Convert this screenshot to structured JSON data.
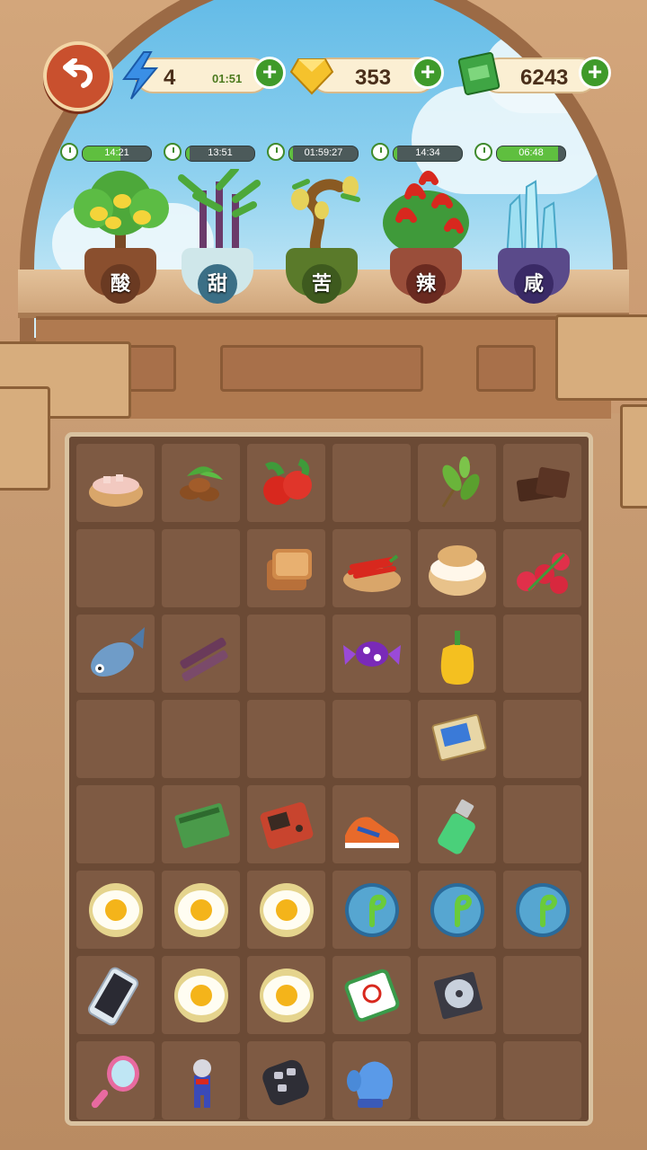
{
  "top_bar": {
    "energy": {
      "value": "4",
      "timer": "01:51"
    },
    "gems": {
      "value": "353"
    },
    "cash": {
      "value": "6243"
    }
  },
  "plants": [
    {
      "label": "酸",
      "timer": "14:21",
      "progress": 0.55,
      "icon": "lemon-tree-icon"
    },
    {
      "label": "甜",
      "timer": "13:51",
      "progress": 0.05,
      "icon": "sugarcane-plant-icon"
    },
    {
      "label": "苦",
      "timer": "01:59:27",
      "progress": 0.05,
      "icon": "bitter-gourd-plant-icon"
    },
    {
      "label": "辣",
      "timer": "14:34",
      "progress": 0.05,
      "icon": "chili-plant-icon"
    },
    {
      "label": "咸",
      "timer": "06:48",
      "progress": 0.9,
      "icon": "salt-crystal-plant-icon"
    }
  ],
  "board": {
    "rows": [
      [
        "salt-bowl",
        "coffee-beans",
        "hawthorn-berries",
        "",
        "tea-leaves",
        "chocolate"
      ],
      [
        "",
        "",
        "toast-bread",
        "chili-bowl",
        "cream-puff",
        "raspberries"
      ],
      [
        "fish",
        "sugarcane",
        "",
        "candy",
        "bell-pepper",
        ""
      ],
      [
        "",
        "",
        "",
        "",
        "trading-card",
        ""
      ],
      [
        "",
        "notebook",
        "handheld-game",
        "sneaker",
        "lighter",
        ""
      ],
      [
        "fried-egg",
        "fried-egg",
        "fried-egg",
        "sprout-bubble",
        "sprout-bubble",
        "sprout-bubble"
      ],
      [
        "smartphone",
        "fried-egg",
        "fried-egg",
        "mahjong-tile",
        "cd-case",
        ""
      ],
      [
        "hand-mirror",
        "hero-figure",
        "car-key",
        "blue-mitten",
        "",
        ""
      ]
    ]
  }
}
